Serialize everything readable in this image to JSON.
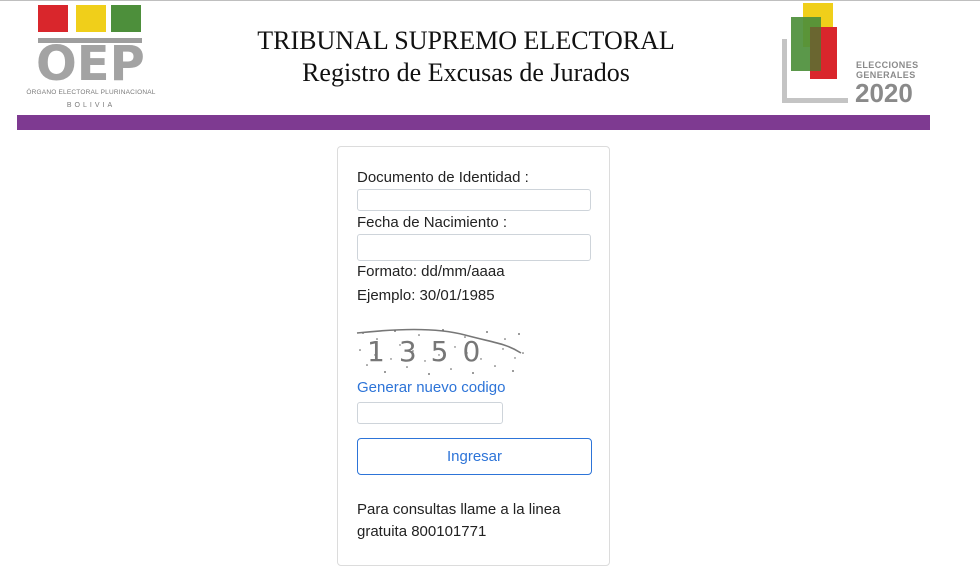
{
  "header": {
    "logo_left": {
      "text": "OEP",
      "subtitle": "ÓRGANO ELECTORAL PLURINACIONAL",
      "country": "BOLIVIA"
    },
    "title": "TRIBUNAL SUPREMO ELECTORAL",
    "subtitle": "Registro de Excusas de Jurados",
    "logo_right": {
      "line1": "ELECCIONES",
      "line2": "GENERALES",
      "year": "2020"
    },
    "colors": {
      "purple_bar": "#7e3a91",
      "flag_red": "#d9262c",
      "flag_yellow": "#f0cf1a",
      "flag_green": "#4d8f3b"
    }
  },
  "form": {
    "documento_label": "Documento de Identidad :",
    "documento_value": "",
    "fecha_label": "Fecha de Nacimiento :",
    "fecha_value": "",
    "formato_text": "Formato: dd/mm/aaaa",
    "ejemplo_text": "Ejemplo: 30/01/1985",
    "captcha_text": "1350",
    "new_code_link": "Generar nuevo codigo",
    "captcha_value": "",
    "submit_label": "Ingresar",
    "help_text": "Para consultas llame a la linea gratuita 800101771",
    "colors": {
      "link": "#2d74d8"
    }
  }
}
